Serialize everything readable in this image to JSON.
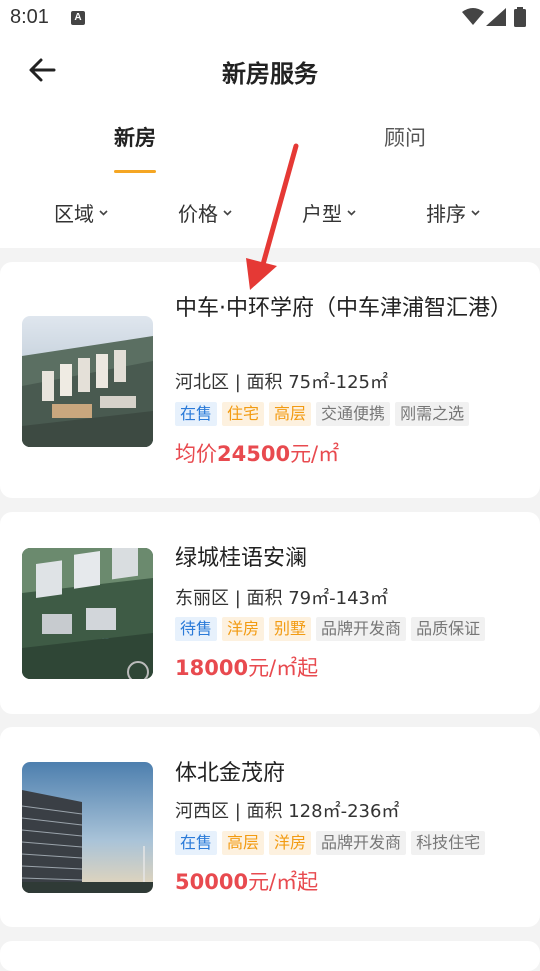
{
  "status": {
    "time": "8:01",
    "notif_icon_letter": "A"
  },
  "header": {
    "title": "新房服务"
  },
  "tabs": [
    {
      "label": "新房",
      "active": true
    },
    {
      "label": "顾问",
      "active": false
    }
  ],
  "filters": [
    {
      "label": "区域"
    },
    {
      "label": "价格"
    },
    {
      "label": "户型"
    },
    {
      "label": "排序"
    }
  ],
  "listings": [
    {
      "name": "中车·中环学府（中车津浦智汇港）",
      "info": "河北区 | 面积 75㎡-125㎡",
      "tags": [
        {
          "text": "在售",
          "style": "blue"
        },
        {
          "text": "住宅",
          "style": "orange"
        },
        {
          "text": "高层",
          "style": "orange"
        },
        {
          "text": "交通便携",
          "style": "gray"
        },
        {
          "text": "刚需之选",
          "style": "gray"
        }
      ],
      "price_prefix": "均价",
      "price_value": "24500",
      "price_suffix": "元/㎡"
    },
    {
      "name": "绿城桂语安澜",
      "info": "东丽区 | 面积 79㎡-143㎡",
      "tags": [
        {
          "text": "待售",
          "style": "blue"
        },
        {
          "text": "洋房",
          "style": "orange"
        },
        {
          "text": "别墅",
          "style": "orange"
        },
        {
          "text": "品牌开发商",
          "style": "gray"
        },
        {
          "text": "品质保证",
          "style": "gray"
        }
      ],
      "price_prefix": "",
      "price_value": "18000",
      "price_suffix": "元/㎡起"
    },
    {
      "name": "体北金茂府",
      "info": "河西区 | 面积 128㎡-236㎡",
      "tags": [
        {
          "text": "在售",
          "style": "blue"
        },
        {
          "text": "高层",
          "style": "orange"
        },
        {
          "text": "洋房",
          "style": "orange"
        },
        {
          "text": "品牌开发商",
          "style": "gray"
        },
        {
          "text": "科技住宅",
          "style": "gray"
        }
      ],
      "price_prefix": "",
      "price_value": "50000",
      "price_suffix": "元/㎡起"
    }
  ],
  "colors": {
    "accent": "#f5a623",
    "price": "#e84a4f",
    "annotation_arrow": "#e53935"
  }
}
